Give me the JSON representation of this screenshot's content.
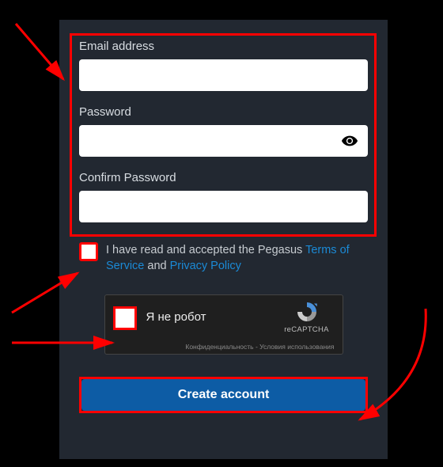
{
  "form": {
    "email_label": "Email address",
    "password_label": "Password",
    "confirm_label": "Confirm Password"
  },
  "consent": {
    "prefix": "I have read and accepted the Pegasus ",
    "tos_label": "Terms of Service",
    "joiner": " and ",
    "privacy_label": "Privacy Policy"
  },
  "captcha": {
    "label": "Я не робот",
    "brand": "reCAPTCHA",
    "footer": "Конфиденциальность - Условия использования"
  },
  "submit": {
    "label": "Create account"
  }
}
